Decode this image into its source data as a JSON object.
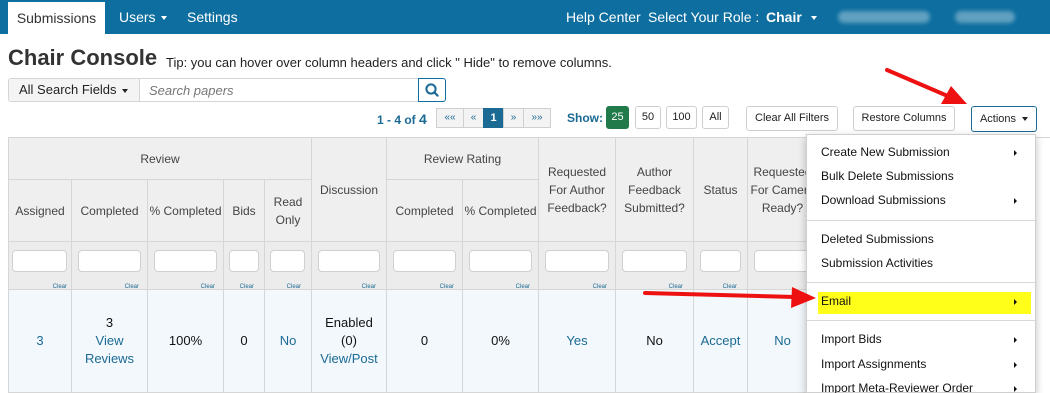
{
  "nav": {
    "submissions": "Submissions",
    "users": "Users",
    "settings": "Settings",
    "help_center": "Help Center",
    "select_role_label": "Select Your Role :",
    "role": "Chair"
  },
  "header": {
    "title": "Chair Console",
    "tip": "Tip: you can hover over column headers and click \" Hide\" to remove columns."
  },
  "search": {
    "fields_label": "All Search Fields",
    "placeholder": "Search papers"
  },
  "pagination": {
    "range_prefix": "1 - 4 of",
    "total": "4",
    "first": "««",
    "prev": "«",
    "current": "1",
    "next": "»",
    "last": "»»"
  },
  "page_size": {
    "label": "Show:",
    "options": [
      "25",
      "50",
      "100",
      "All"
    ],
    "selected": "25"
  },
  "toolbar": {
    "clear_filters": "Clear All Filters",
    "restore_columns": "Restore Columns",
    "actions": "Actions"
  },
  "table": {
    "group_headers": {
      "review": "Review",
      "discussion": "Discussion",
      "review_rating": "Review Rating",
      "requested_author_feedback": "Requested For Author Feedback?",
      "author_feedback_submitted": "Author Feedback Submitted?",
      "status": "Status",
      "requested_camera_ready": "Requested For Camera Ready?"
    },
    "sub_headers": {
      "assigned": "Assigned",
      "completed": "Completed",
      "pct_completed": "% Completed",
      "bids": "Bids",
      "read_only": "Read Only",
      "rating_completed": "Completed",
      "rating_pct_completed": "% Completed"
    },
    "clear_label": "Clear",
    "row": {
      "assigned": "3",
      "completed_count": "3",
      "view_reviews": "View Reviews",
      "pct_completed": "100%",
      "bids": "0",
      "read_only": "No",
      "discussion_status": "Enabled",
      "discussion_count": "(0)",
      "view_post": "View/Post",
      "rating_completed": "0",
      "rating_pct": "0%",
      "requested_author_feedback": "Yes",
      "author_feedback_submitted": "No",
      "status": "Accept",
      "requested_camera_ready": "No"
    }
  },
  "actions_menu": {
    "items": [
      {
        "label": "Create New Submission",
        "submenu": true
      },
      {
        "label": "Bulk Delete Submissions",
        "submenu": false
      },
      {
        "label": "Download Submissions",
        "submenu": true
      },
      {
        "label": "Deleted Submissions",
        "submenu": false
      },
      {
        "label": "Submission Activities",
        "submenu": false
      },
      {
        "label": "Email",
        "submenu": true
      },
      {
        "label": "Import Bids",
        "submenu": true
      },
      {
        "label": "Import Assignments",
        "submenu": true
      },
      {
        "label": "Import Meta-Reviewer Order",
        "submenu": true
      }
    ]
  },
  "colors": {
    "nav_bg": "#0d6e9f",
    "link": "#1b6a94",
    "page_size_active": "#217a4a",
    "highlight": "#ffff1a",
    "annotation_arrow": "#ee1111"
  },
  "icons": {
    "search": "magnifier-icon",
    "dropdown": "caret-down-icon",
    "submenu": "caret-right-icon",
    "annotation": "red-arrow-icon"
  }
}
